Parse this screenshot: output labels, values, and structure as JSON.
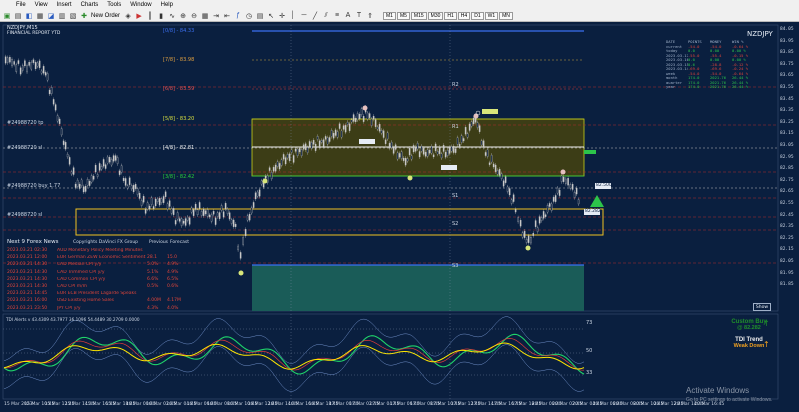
{
  "menu": [
    "File",
    "View",
    "Insert",
    "Charts",
    "Tools",
    "Window",
    "Help"
  ],
  "toolbar": {
    "new_order": "New Order",
    "timeframes": [
      "M1",
      "M5",
      "M15",
      "M30",
      "H1",
      "H4",
      "D1",
      "W1",
      "MN"
    ]
  },
  "chart": {
    "symbol_title": "NZDJPY,M15",
    "financial_title": "FINANCIAL REPORT YTD",
    "symbol_big": "NZDJPY",
    "price_axis": [
      "84.05",
      "83.95",
      "83.85",
      "83.75",
      "83.65",
      "83.55",
      "83.45",
      "83.35",
      "83.25",
      "83.15",
      "83.05",
      "82.95",
      "82.85",
      "82.75",
      "82.65",
      "82.55",
      "82.45",
      "82.35",
      "82.25",
      "82.15",
      "82.05",
      "81.95",
      "81.85"
    ],
    "time_axis": [
      "15 Mar 2023",
      "15 Mar 10:45",
      "15 Mar 12:45",
      "15 Mar 14:45",
      "15 Mar 16:45",
      "15 Mar 18:45",
      "16 Mar 00:45",
      "16 Mar 02:45",
      "16 Mar 04:45",
      "16 Mar 06:45",
      "16 Mar 08:45",
      "16 Mar 10:45",
      "16 Mar 12:45",
      "16 Mar 14:45",
      "16 Mar 16:45",
      "16 Mar 18:45",
      "17 Mar 00:45",
      "17 Mar 02:45",
      "17 Mar 04:45",
      "17 Mar 06:45",
      "17 Mar 08:45",
      "17 Mar 10:45",
      "17 Mar 12:45",
      "17 Mar 14:45",
      "17 Mar 16:45",
      "17 Mar 18:45",
      "20 Mar 00:45",
      "20 Mar 02:45",
      "20 Mar 04:45",
      "20 Mar 06:45",
      "20 Mar 08:45",
      "20 Mar 10:45",
      "20 Mar 12:45",
      "20 Mar 14:45",
      "20 Mar 16:45"
    ],
    "fib_labels": [
      "[0/8] - 84.33",
      "[7/8] - 83.98",
      "[6/8] - 83.59",
      "[5/8] - 83.20",
      "[4/8] - 82.81",
      "[3/8] - 82.42"
    ],
    "pivot_labels": [
      "R2",
      "R1",
      "S1",
      "S2",
      "S3"
    ],
    "left_labels": [
      "#24988720 tp",
      "#24988720 sl",
      "#24988720 buy 1.77",
      "#24988720 sl"
    ],
    "price_tag": "82.500",
    "price_tag2": "82.282"
  },
  "stats": {
    "headers": [
      "DATE",
      "POINTS",
      "MONEY",
      "WIN %"
    ],
    "rows": [
      [
        "current",
        "-54.0",
        "-54.0",
        "-0.64 %"
      ],
      [
        "today",
        "0.0",
        "0.00",
        "0.00 %"
      ],
      [
        "2023.03.17",
        "-55.0",
        "-55.4",
        "-0.15 %"
      ],
      [
        "2023.03.16",
        "0.0",
        "0.00",
        "0.00 %"
      ],
      [
        "2023.03.15",
        "8.6",
        "-28.8",
        "-0.12 %"
      ],
      [
        "2023.03.14",
        "-69.0",
        "-69.6",
        "-0.24 %"
      ],
      [
        "week",
        "-54.0",
        "-54.0",
        "-0.64 %"
      ],
      [
        "month",
        "174.0",
        "2021.76",
        "26.44 %"
      ],
      [
        "quarter",
        "174.0",
        "2021.76",
        "26.44 %"
      ],
      [
        "year",
        "174.0",
        "2021.76",
        "26.44 %"
      ]
    ]
  },
  "news": {
    "title": "Next 9 Forex News",
    "copyright": "Copyrights DaVinci FX Group",
    "previous": "Previous",
    "forecast": "Forecast",
    "rows": [
      {
        "date": "2023.03.21 02:30",
        "event": "AUD  Monetary Policy Meeting Minutes",
        "actual": "",
        "prev": ""
      },
      {
        "date": "2023.03.21 12:00",
        "event": "EUR  German ZEW Economic Sentiment",
        "actual": "28.1",
        "prev": "15.0"
      },
      {
        "date": "2023.03.21 14:30",
        "event": "CAD  Median CPI y/y",
        "actual": "5.0%",
        "prev": "4.9%"
      },
      {
        "date": "2023.03.21 14:30",
        "event": "CAD  Trimmed CPI y/y",
        "actual": "5.1%",
        "prev": "4.9%"
      },
      {
        "date": "2023.03.21 14:30",
        "event": "CAD  Common CPI y/y",
        "actual": "6.6%",
        "prev": "6.5%"
      },
      {
        "date": "2023.03.21 14:30",
        "event": "CAD  CPI m/m",
        "actual": "0.5%",
        "prev": "0.6%"
      },
      {
        "date": "2023.03.21 14:45",
        "event": "EUR  ECB President Lagarde Speaks",
        "actual": "",
        "prev": ""
      },
      {
        "date": "2023.03.21 16:00",
        "event": "USD  Existing Home Sales",
        "actual": "4.00M",
        "prev": "4.17M"
      },
      {
        "date": "2023.03.21 23:50",
        "event": "JPY  CPI y/y",
        "actual": "4.3%",
        "prev": "4.0%"
      }
    ]
  },
  "show_button": "Show",
  "tdi": {
    "title": "TDI Alerts",
    "info": "TDI Alerts v 43.4309 43.7977 36.1096 54.4489 30.2709 0.0000",
    "line1": "Custom Buy",
    "line2": "@ 82.282",
    "line3": "TDI Trend",
    "line4": "Weak Down",
    "axis": [
      "73",
      "50",
      "33"
    ]
  },
  "watermark": {
    "line1": "Activate Windows",
    "line2": "Go to PC settings to activate Windows."
  },
  "colors": {
    "background": "#0a1f3f",
    "candle": "#c8c8c8",
    "zone_fill": "#3c3d16",
    "green_zone": "#1a5c58",
    "buy_arrow": "#2cc44a",
    "tdi_green": "#1fd36a",
    "tdi_yellow": "#ffe600"
  }
}
